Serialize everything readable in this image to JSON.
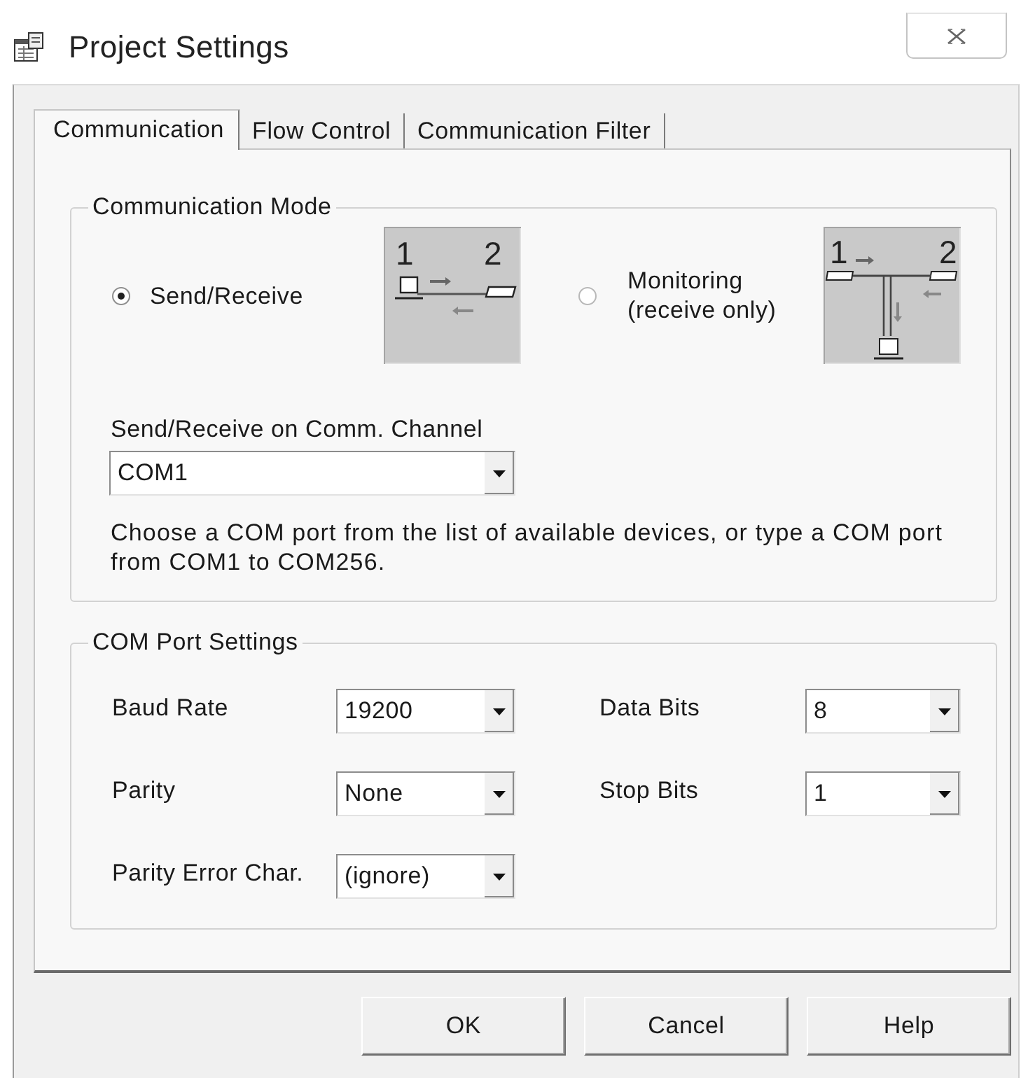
{
  "window": {
    "title": "Project Settings"
  },
  "tabs": [
    {
      "label": "Communication",
      "selected": true
    },
    {
      "label": "Flow Control",
      "selected": false
    },
    {
      "label": "Communication Filter",
      "selected": false
    }
  ],
  "communication_mode": {
    "title": "Communication Mode",
    "options": [
      {
        "label": "Send/Receive",
        "selected": true,
        "kind": "point_to_point",
        "diagram_labels": [
          "1",
          "2"
        ]
      },
      {
        "label": "Monitoring\n(receive only)",
        "selected": false,
        "kind": "monitoring",
        "diagram_labels": [
          "1",
          "2"
        ]
      }
    ],
    "channel": {
      "label": "Send/Receive on Comm. Channel",
      "value": "COM1"
    },
    "hint": "Choose a COM port from the list of available devices, or type a COM port from COM1 to COM256."
  },
  "com_port_settings": {
    "title": "COM Port Settings",
    "fields": [
      {
        "label": "Baud Rate",
        "value": "19200"
      },
      {
        "label": "Data Bits",
        "value": "8"
      },
      {
        "label": "Parity",
        "value": "None"
      },
      {
        "label": "Stop Bits",
        "value": "1"
      },
      {
        "label": "Parity Error Char.",
        "value": "(ignore)"
      }
    ]
  },
  "buttons": [
    {
      "label": "OK"
    },
    {
      "label": "Cancel"
    },
    {
      "label": "Help"
    }
  ]
}
